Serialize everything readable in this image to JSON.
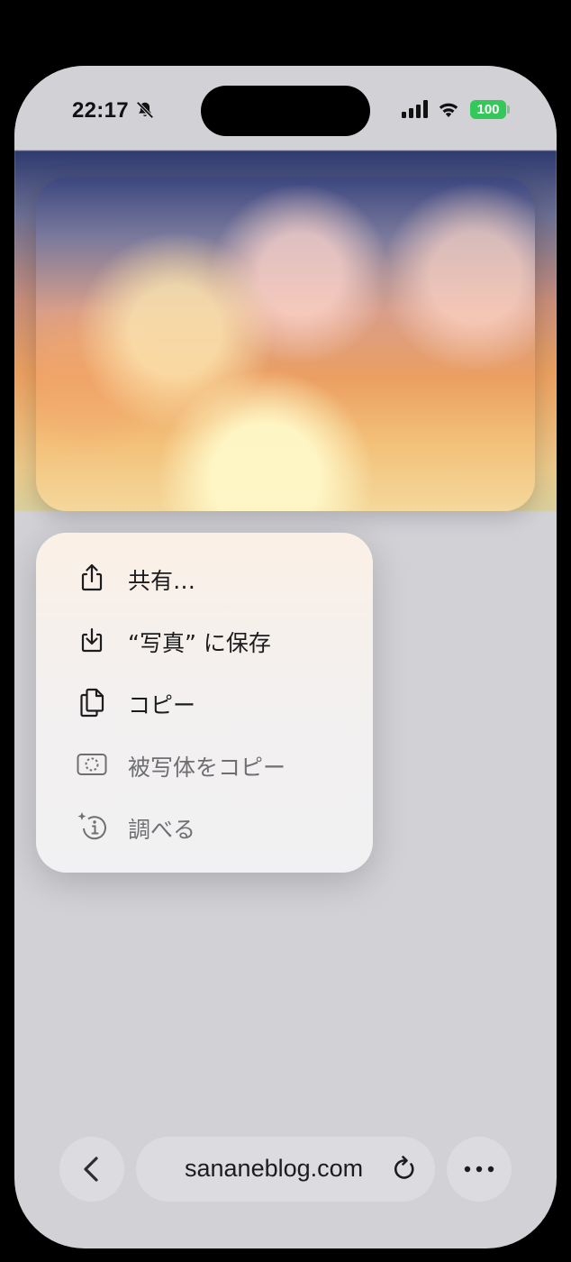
{
  "status_bar": {
    "time": "22:17",
    "battery": "100",
    "icons": [
      "bell-slash-icon",
      "cellular-signal-icon",
      "wifi-icon",
      "battery-icon"
    ],
    "battery_color": "#34c759"
  },
  "preview_image": {
    "description_icon": "photo"
  },
  "context_menu": {
    "items": [
      {
        "label": "共有…",
        "icon": "share-icon",
        "enabled": true
      },
      {
        "label": "“写真” に保存",
        "icon": "save-download-icon",
        "enabled": true
      },
      {
        "label": "コピー",
        "icon": "copy-icon",
        "enabled": true
      },
      {
        "label": "被写体をコピー",
        "icon": "subject-lift-icon",
        "enabled": false
      },
      {
        "label": "調べる",
        "icon": "visual-lookup-icon",
        "enabled": false
      }
    ]
  },
  "toolbar": {
    "url": "sananeblog.com",
    "icons": [
      "chevron-left-icon",
      "reload-icon",
      "more-icon"
    ]
  }
}
